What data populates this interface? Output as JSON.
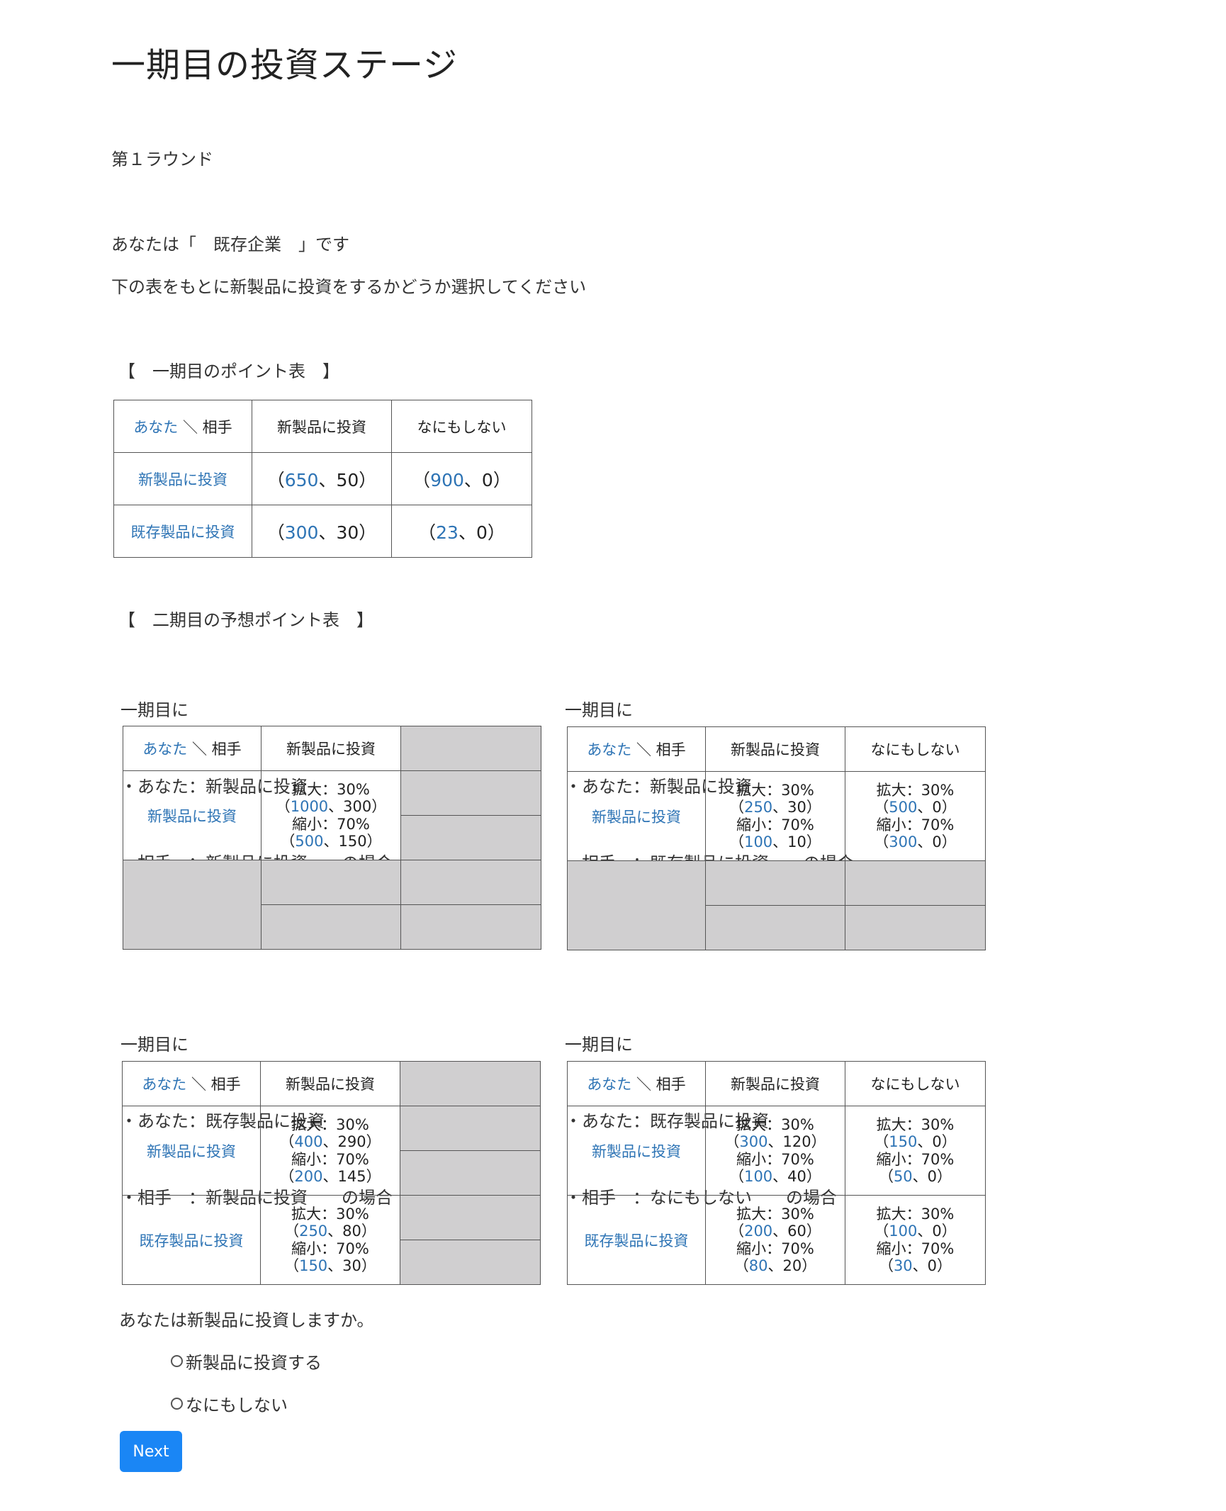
{
  "title": "一期目の投資ステージ",
  "round_label": "第１ラウンド",
  "role_line": "あなたは「　既存企業　」です",
  "instruction": "下の表をもとに新製品に投資をするかどうか選択してください",
  "table1": {
    "heading": "【　一期目のポイント表　】",
    "corner_you": "あなた",
    "corner_sep": " ＼ ",
    "corner_opp": "相手",
    "col1": "新製品に投資",
    "col2": "なにもしない",
    "rows": [
      {
        "label": "新製品に投資",
        "c1": {
          "a": "650",
          "b": "50"
        },
        "c2": {
          "a": "900",
          "b": "0"
        }
      },
      {
        "label": "既存製品に投資",
        "c1": {
          "a": "300",
          "b": "30"
        },
        "c2": {
          "a": "23",
          "b": "0"
        }
      }
    ]
  },
  "table2_heading": "【　二期目の予想ポイント表　】",
  "scenarios": [
    {
      "caption": [
        "一期目に",
        "・あなた：新製品に投資",
        "・相手　：新製品に投資　　の場合"
      ],
      "corner_you": "あなた",
      "corner_sep": " ＼ ",
      "corner_opp": "相手",
      "col1": "新製品に投資",
      "col2": "",
      "rows": [
        {
          "label": "新製品に投資",
          "c1": {
            "up": "拡大：30%",
            "upa": "1000",
            "upb": "300",
            "down": "縮小：70%",
            "downa": "500",
            "downb": "150"
          },
          "c2": null
        },
        {
          "label": "",
          "c1": null,
          "c2": null
        }
      ]
    },
    {
      "caption": [
        "一期目に",
        "・あなた：新製品に投資",
        "・相手　：既存製品に投資　　の場合"
      ],
      "corner_you": "あなた",
      "corner_sep": " ＼ ",
      "corner_opp": "相手",
      "col1": "新製品に投資",
      "col2": "なにもしない",
      "rows": [
        {
          "label": "新製品に投資",
          "c1": {
            "up": "拡大：30%",
            "upa": "250",
            "upb": "30",
            "down": "縮小：70%",
            "downa": "100",
            "downb": "10"
          },
          "c2": {
            "up": "拡大：30%",
            "upa": "500",
            "upb": "0",
            "down": "縮小：70%",
            "downa": "300",
            "downb": "0"
          }
        },
        {
          "label": "",
          "c1": null,
          "c2": null
        }
      ]
    },
    {
      "caption": [
        "一期目に",
        "・あなた：既存製品に投資",
        "・相手　：新製品に投資　　の場合"
      ],
      "corner_you": "あなた",
      "corner_sep": " ＼ ",
      "corner_opp": "相手",
      "col1": "新製品に投資",
      "col2": "",
      "rows": [
        {
          "label": "新製品に投資",
          "c1": {
            "up": "拡大：30%",
            "upa": "400",
            "upb": "290",
            "down": "縮小：70%",
            "downa": "200",
            "downb": "145"
          },
          "c2": null
        },
        {
          "label": "既存製品に投資",
          "c1": {
            "up": "拡大：30%",
            "upa": "250",
            "upb": "80",
            "down": "縮小：70%",
            "downa": "150",
            "downb": "30"
          },
          "c2": null
        }
      ]
    },
    {
      "caption": [
        "一期目に",
        "・あなた：既存製品に投資",
        "・相手　：なにもしない　　の場合"
      ],
      "corner_you": "あなた",
      "corner_sep": " ＼ ",
      "corner_opp": "相手",
      "col1": "新製品に投資",
      "col2": "なにもしない",
      "rows": [
        {
          "label": "新製品に投資",
          "c1": {
            "up": "拡大：30%",
            "upa": "300",
            "upb": "120",
            "down": "縮小：70%",
            "downa": "100",
            "downb": "40"
          },
          "c2": {
            "up": "拡大：30%",
            "upa": "150",
            "upb": "0",
            "down": "縮小：70%",
            "downa": "50",
            "downb": "0"
          }
        },
        {
          "label": "既存製品に投資",
          "c1": {
            "up": "拡大：30%",
            "upa": "200",
            "upb": "60",
            "down": "縮小：70%",
            "downa": "80",
            "downb": "20"
          },
          "c2": {
            "up": "拡大：30%",
            "upa": "100",
            "upb": "0",
            "down": "縮小：70%",
            "downa": "30",
            "downb": "0"
          }
        }
      ]
    }
  ],
  "question": "あなたは新製品に投資しますか。",
  "options": [
    "新製品に投資する",
    "なにもしない"
  ],
  "next_label": "Next",
  "colors": {
    "accent": "#1a86f5",
    "label_blue": "#2e74b5",
    "grey_cell": "#d0cfd0"
  }
}
